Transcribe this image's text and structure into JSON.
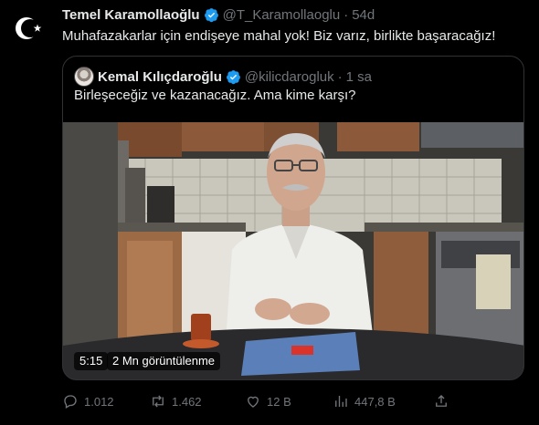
{
  "tweet": {
    "author_name": "Temel Karamollaoğlu",
    "handle": "@T_Karamollaoglu",
    "separator": "·",
    "time": "54d",
    "text": "Muhafazakarlar için endişeye mahal yok! Biz varız, birlikte başaracağız!",
    "avatar_icon": "crescent-star-icon"
  },
  "quote": {
    "author_name": "Kemal Kılıçdaroğlu",
    "handle": "@kilicdarogluk",
    "separator": "·",
    "time": "1 sa",
    "text": "Birleşeceğiz ve kazanacağız. Ama kime karşı?",
    "video": {
      "duration": "5:15",
      "views": "2 Mn görüntülenme"
    }
  },
  "actions": {
    "replies": "1.012",
    "retweets": "1.462",
    "likes": "12 B",
    "views": "447,8 B",
    "share_icon": "share-icon"
  },
  "colors": {
    "background": "#000000",
    "text": "#e7e9ea",
    "muted": "#71767b",
    "verified": "#1d9bf0",
    "border": "#2f3336"
  }
}
